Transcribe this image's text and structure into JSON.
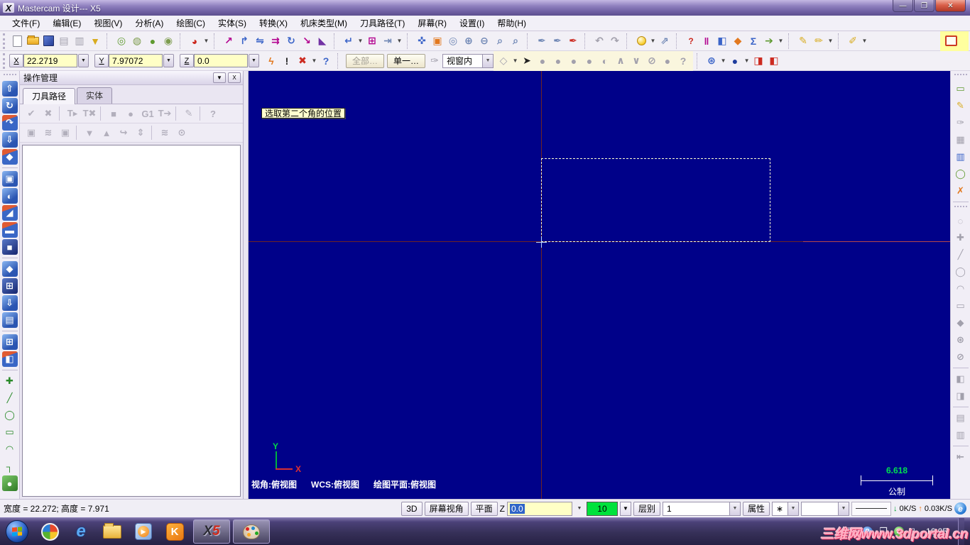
{
  "window": {
    "title": "Mastercam 设计--- X5",
    "minimize": "—",
    "restore": "❐",
    "close": "✕"
  },
  "menu": [
    "文件(F)",
    "编辑(E)",
    "视图(V)",
    "分析(A)",
    "绘图(C)",
    "实体(S)",
    "转换(X)",
    "机床类型(M)",
    "刀具路径(T)",
    "屏幕(R)",
    "设置(I)",
    "帮助(H)"
  ],
  "coords": {
    "x_label": "X",
    "x_value": "22.2719",
    "y_label": "Y",
    "y_value": "7.97072",
    "z_label": "Z",
    "z_value": "0.0"
  },
  "selection": {
    "all": "全部…",
    "single": "单一…",
    "in_view": "视窗内"
  },
  "op_manager": {
    "title": "操作管理",
    "tab_toolpaths": "刀具路径",
    "tab_solids": "实体"
  },
  "drawing": {
    "prompt": "选取第二个角的位置",
    "axis_x": "X",
    "axis_y": "Y",
    "view_label": "视角:俯视图",
    "wcs_label": "WCS:俯视图",
    "cplane_label": "绘图平面:俯视图",
    "scale_value": "6.618",
    "units": "公制"
  },
  "status": {
    "size_info": "宽度 = 22.272; 高度 = 7.971",
    "mode_3d": "3D",
    "screen_view": "屏幕视角",
    "plane": "平面",
    "z_label": "Z",
    "z_value": "0.0",
    "grid_value": "10",
    "level_label": "层别",
    "level_value": "1",
    "attributes": "属性",
    "point_style": "∗",
    "net_down_arrow": "↓",
    "net_down": "0K/S",
    "net_up_arrow": "↑",
    "net_up": "0.03K/S",
    "ie_label": "e"
  },
  "taskbar": {
    "time": "16:05",
    "watermark": "三维网www.3dportal.cn",
    "k_label": "K",
    "ie_label": "e",
    "wmp_play": "▶",
    "x5_x": "X",
    "x5_5": "5"
  },
  "icons": {
    "dd": "▼",
    "print": "▤",
    "preview": "▥",
    "merge": "▼",
    "shade_wireframe": "◎",
    "shade_hidden": "◍",
    "shade_flat": "●",
    "shade_gouraud": "◉",
    "render": "◕",
    "xform_translate": "↗",
    "xform_translate3d": "↱",
    "xform_mirror": "⇋",
    "xform_offset": "⇉",
    "xform_rotate": "↻",
    "xform_scale": "↘",
    "xform_dynamic": "◣",
    "delete_entities": "↵",
    "screen_blank": "⊞",
    "exit_arrow": "⇥",
    "fit": "✜",
    "zoom_window": "▣",
    "zoom_target": "◎",
    "zoom_in": "⊕",
    "zoom_out": "⊖",
    "magnifier": "⌕",
    "blank_pen": "✒",
    "undo": "↶",
    "redo": "↷",
    "grid_params": "⇗",
    "analyze_entity": "?",
    "analyze_distance": "‖",
    "analyze_dynamic": "◧",
    "analyze_angle": "◆",
    "analyze_area": "Σ",
    "analyze_chain": "➔",
    "attr_pencil": "✎",
    "attr_multi": "✏",
    "attr_set": "✐",
    "bolt": "ϟ",
    "excl": "!",
    "clear_xyz": "✖",
    "help": "?",
    "sel_polygon": "◇",
    "sel_cursor": "➤",
    "sel_blob": "●",
    "sel_sphere": "◐",
    "sel_up": "∧",
    "sel_chain": "∨",
    "sel_no": "⊘",
    "sel_big": "●",
    "sel_help": "?",
    "wcs_globe": "⊛",
    "planes_sphere": "●",
    "solid_red_a": "◨",
    "solid_red_b": "◧",
    "op_select_all": "✔",
    "op_deselect": "✖",
    "op_regen": "T▸",
    "op_regen_x": "T✖",
    "op_square": "■",
    "op_blob": "●",
    "op_g1": "G1",
    "op_post": "T➔",
    "op_edit": "✎",
    "op_help": "?",
    "op_lock": "▣",
    "op_wave": "≋",
    "op_lock2": "▣",
    "op_down": "▼",
    "op_up": "▲",
    "op_return": "↪",
    "op_updown": "⇕",
    "op_wave2": "≋",
    "op_circle": "⊙",
    "ls_extrude": "⇧",
    "ls_revolve": "↻",
    "ls_sweep": "↷",
    "ls_loft": "⇩",
    "ls_fillet": "◆",
    "ls_shell": "▣",
    "ls_boolean": "◐",
    "ls_draft": "◢",
    "ls_thicken": "▬",
    "ls_block": "■",
    "ls_history": "◆",
    "ls_quad": "⊞",
    "ls_push": "⇩",
    "ls_panel": "▤",
    "ls_window": "⊞",
    "ls_primitives": "◧",
    "draw_point": "✚",
    "draw_line": "╱",
    "draw_circle": "◯",
    "draw_rect": "▭",
    "draw_fillet": "◠",
    "draw_polyline": "┐",
    "draw_cylinder": "●",
    "r_rect": "▭",
    "r_pencil": "✎",
    "r_hand": "✑",
    "r_grid": "▦",
    "r_screen": "▥",
    "r_circle": "◯",
    "r_delete": "✗",
    "r_repaint": "◌",
    "r_plus": "✚",
    "r_line": "╱",
    "r_circ2": "◯",
    "r_arc": "◠",
    "r_rect2": "▭",
    "r_poly": "◆",
    "r_globe": "⊛",
    "r_no": "⊘",
    "r_surf1": "◧",
    "r_surf2": "◨",
    "r_surf3": "▤",
    "r_surf4": "▥",
    "r_scale_arrow": "⇤",
    "tray_keyboard": "⌨",
    "tray_help": "?",
    "tray_window": "❒",
    "tray_shield": "✔",
    "tray_plug": "▯"
  }
}
